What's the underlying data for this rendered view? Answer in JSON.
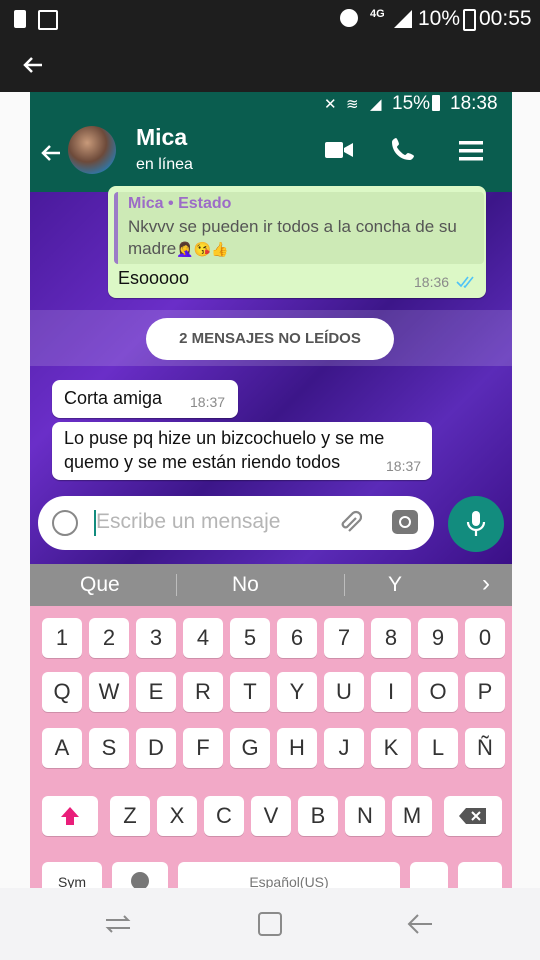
{
  "outer_status": {
    "network": "4G",
    "battery": "10%",
    "time": "00:55"
  },
  "inner_status": {
    "battery": "15%",
    "time": "18:38"
  },
  "chat_header": {
    "name": "Mica",
    "status": "en línea"
  },
  "quoted_message": {
    "author": "Mica • Estado",
    "text": "Nkvvv se pueden ir todos a la concha de su madre",
    "emojis": "🤦‍♀️😘👍"
  },
  "messages": [
    {
      "direction": "out",
      "text": "Esooooo",
      "time": "18:36"
    },
    {
      "direction": "in",
      "text": "Corta amiga",
      "time": "18:37"
    },
    {
      "direction": "in",
      "text_line1": "Lo puse pq hize un bizcochuelo y se me",
      "text_line2": "quemo y se me están riendo todos",
      "time": "18:37"
    }
  ],
  "unread_banner": "2 MENSAJES NO LEÍDOS",
  "composer": {
    "placeholder": "Escribe un mensaje"
  },
  "keyboard": {
    "suggestions": [
      "Que",
      "No",
      "Y"
    ],
    "row_numbers": [
      "1",
      "2",
      "3",
      "4",
      "5",
      "6",
      "7",
      "8",
      "9",
      "0"
    ],
    "row_1": [
      "Q",
      "W",
      "E",
      "R",
      "T",
      "Y",
      "U",
      "I",
      "O",
      "P"
    ],
    "row_2": [
      "A",
      "S",
      "D",
      "F",
      "G",
      "H",
      "J",
      "K",
      "L",
      "Ñ"
    ],
    "row_3": [
      "Z",
      "X",
      "C",
      "V",
      "B",
      "N",
      "M"
    ],
    "space_label": "Español(US)",
    "sym_label": "Sym"
  },
  "colors": {
    "whatsapp_header": "#0a5d4f",
    "accent_teal": "#128c7e",
    "chat_bg": "#4a1a9c",
    "keyboard_bg": "#f2a9c7",
    "shift_pink": "#e91e7a"
  }
}
